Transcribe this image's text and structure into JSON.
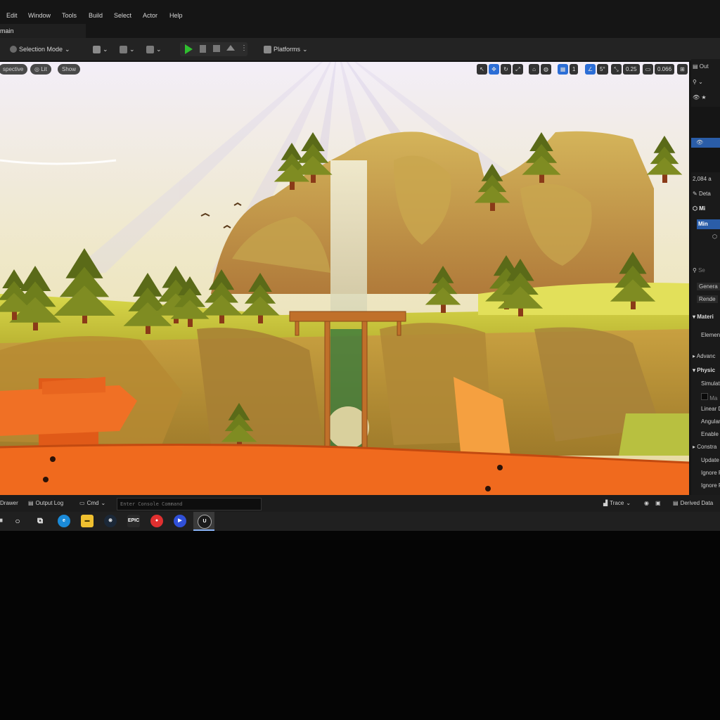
{
  "menu": {
    "items": [
      "Edit",
      "Window",
      "Tools",
      "Build",
      "Select",
      "Actor",
      "Help"
    ]
  },
  "map_tab": {
    "label": "main"
  },
  "toolbar": {
    "selection_mode": "Selection Mode",
    "platforms": "Platforms"
  },
  "viewport": {
    "perspective": "spective",
    "lit": "Lit",
    "show": "Show",
    "grid_value": "1",
    "angle_value": "5°",
    "scale_value": "0.25",
    "camera_speed": "0.066"
  },
  "outliner": {
    "title": "Out",
    "count": "2,084 a"
  },
  "details": {
    "title": "Deta",
    "component1": "Mi",
    "component2": "Min",
    "search": "Se",
    "tab_general": "Genera",
    "tab_rendering": "Rende",
    "section_materials": "Materi",
    "element": "Elemen",
    "advanced": "Advanc",
    "section_physics": "Physic",
    "simulate": "Simulat",
    "mass": "Ma",
    "linear": "Linear D",
    "angular": "Angular",
    "enable": "Enable G",
    "constraints": "Constra",
    "update": "Update",
    "ignore1": "Ignore R",
    "ignore2": "Ignore R"
  },
  "statusbar": {
    "drawer": "Drawer",
    "output_log": "Output Log",
    "cmd": "Cmd",
    "console_placeholder": "Enter Console Command",
    "trace": "Trace",
    "derived_data": "Derived Data"
  },
  "taskbar": {
    "epic_label": "EPIC"
  },
  "colors": {
    "play_green": "#2fbf2f",
    "accent_blue": "#2c6ed6",
    "fence_orange": "#f06a1e"
  }
}
